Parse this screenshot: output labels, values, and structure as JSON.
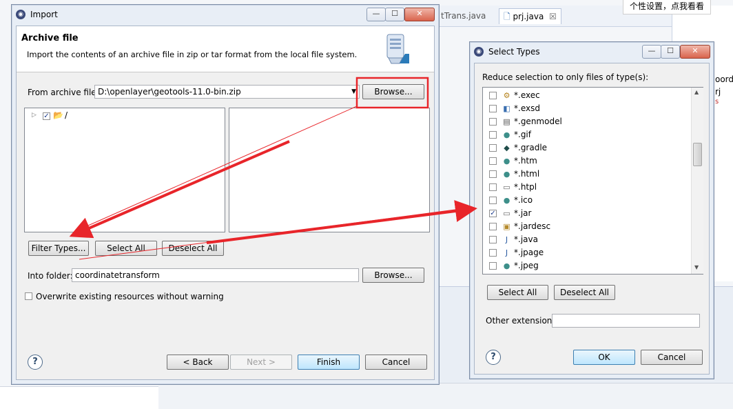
{
  "ide": {
    "tab1": "tTrans.java",
    "tab2": "prj.java",
    "tab2_close": "☒",
    "notice": "个性设置，点我看看",
    "side_text1": "oord",
    "side_text2": "rj",
    "side_text3": "s"
  },
  "import": {
    "title": "Import",
    "minimize": "—",
    "maximize": "☐",
    "close": "✕",
    "heading": "Archive file",
    "description": "Import the contents of an archive file in zip or tar format from the local file system.",
    "from_label": "From archive file:",
    "from_value": "D:\\openlayer\\geotools-11.0-bin.zip",
    "browse_top": "Browse...",
    "tree_root": "/",
    "filter_types": "Filter Types...",
    "select_all": "Select All",
    "deselect_all": "Deselect All",
    "into_label": "Into folder:",
    "into_value": "coordinatetransform",
    "browse_bottom": "Browse...",
    "overwrite": "Overwrite existing resources without warning",
    "back": "< Back",
    "next": "Next >",
    "finish": "Finish",
    "cancel": "Cancel",
    "help": "?"
  },
  "select_types": {
    "title": "Select Types",
    "minimize": "—",
    "maximize": "☐",
    "close": "✕",
    "instruction": "Reduce selection to only files of type(s):",
    "items": [
      {
        "label": "*.exec",
        "checked": false,
        "icon": "gears-icon"
      },
      {
        "label": "*.exsd",
        "checked": false,
        "icon": "schema-icon"
      },
      {
        "label": "*.genmodel",
        "checked": false,
        "icon": "genmodel-icon"
      },
      {
        "label": "*.gif",
        "checked": false,
        "icon": "globe-icon"
      },
      {
        "label": "*.gradle",
        "checked": false,
        "icon": "gradle-icon"
      },
      {
        "label": "*.htm",
        "checked": false,
        "icon": "globe-icon"
      },
      {
        "label": "*.html",
        "checked": false,
        "icon": "globe-icon"
      },
      {
        "label": "*.htpl",
        "checked": false,
        "icon": "file-icon"
      },
      {
        "label": "*.ico",
        "checked": false,
        "icon": "globe-icon"
      },
      {
        "label": "*.jar",
        "checked": true,
        "icon": "file-icon"
      },
      {
        "label": "*.jardesc",
        "checked": false,
        "icon": "jardesc-icon"
      },
      {
        "label": "*.java",
        "checked": false,
        "icon": "java-file-icon"
      },
      {
        "label": "*.jpage",
        "checked": false,
        "icon": "java-file-icon"
      },
      {
        "label": "*.jpeg",
        "checked": false,
        "icon": "globe-icon"
      }
    ],
    "select_all": "Select All",
    "deselect_all": "Deselect All",
    "other_label": "Other extensions:",
    "other_value": "",
    "ok": "OK",
    "cancel": "Cancel",
    "help": "?"
  },
  "colors": {
    "annotation_red": "#e8252a",
    "dialog_frame": "#e8eef6"
  }
}
